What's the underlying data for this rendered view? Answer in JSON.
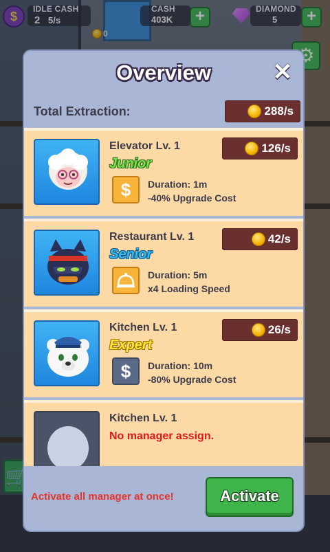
{
  "hud": {
    "idle_cash_label": "IDLE CASH",
    "idle_cash_count": "2",
    "idle_cash_rate": "5/s",
    "cash_label": "CASH",
    "cash_value": "403K",
    "diamond_label": "DIAMOND",
    "diamond_value": "5",
    "plus_symbol": "+",
    "small_coin_count": "0"
  },
  "modal": {
    "title": "Overview",
    "close_symbol": "✕",
    "total_label": "Total Extraction:",
    "total_rate": "288/s"
  },
  "managers": [
    {
      "name": "Elevator Lv. 1",
      "rank": "Junior",
      "rate": "126/s",
      "skill_icon": "dollar-icon",
      "duration": "Duration: 1m",
      "effect": "-40% Upgrade Cost"
    },
    {
      "name": "Restaurant Lv. 1",
      "rank": "Senior",
      "rate": "42/s",
      "skill_icon": "bell-icon",
      "duration": "Duration: 5m",
      "effect": "x4 Loading Speed"
    },
    {
      "name": "Kitchen Lv. 1",
      "rank": "Expert",
      "rate": "26/s",
      "skill_icon": "dollar-icon",
      "duration": "Duration: 10m",
      "effect": "-80% Upgrade Cost"
    },
    {
      "name": "Kitchen Lv. 1",
      "no_manager": "No manager assign."
    }
  ],
  "footer": {
    "hint": "Activate all manager at once!",
    "activate_label": "Activate"
  },
  "colors": {
    "modal_bg": "#a9b6d6",
    "card_bg": "#fcd9a5",
    "rate_pill": "#6a2f2f",
    "activate_green": "#3fb44a",
    "hint_red": "#e3362a"
  }
}
